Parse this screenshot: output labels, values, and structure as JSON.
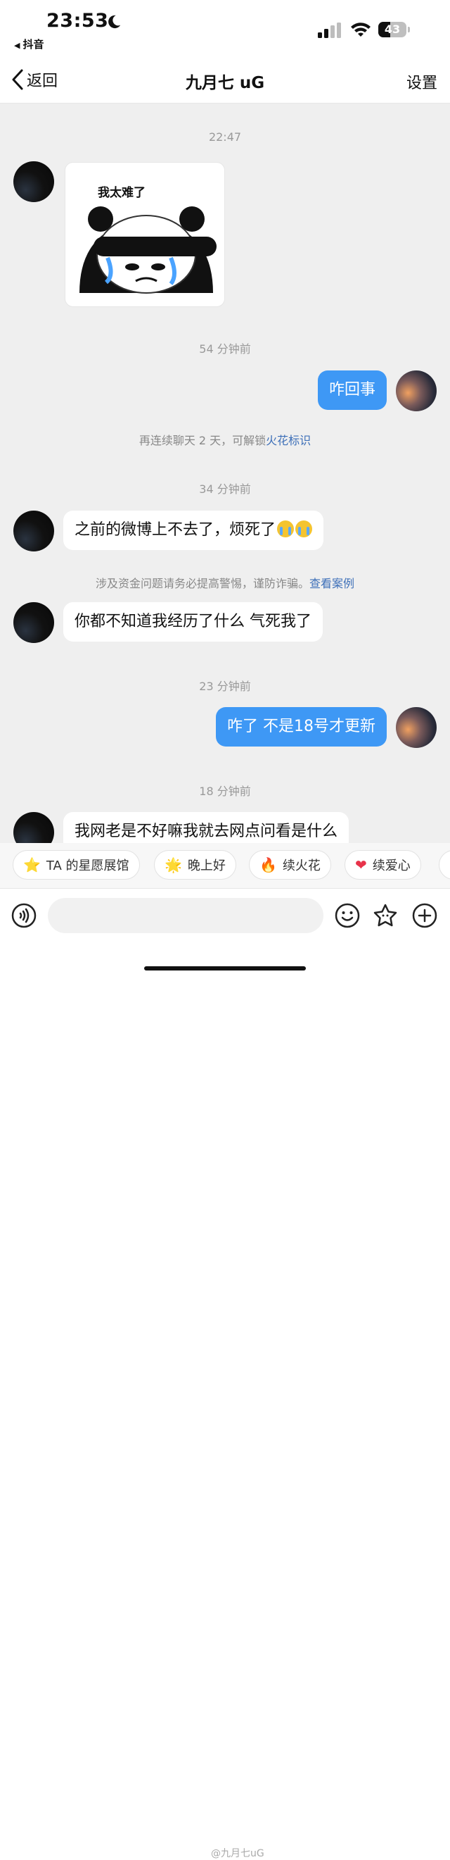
{
  "status_bar": {
    "time": "23:53",
    "back_app": "抖音",
    "battery": "43",
    "battery_level": 0.43
  },
  "nav": {
    "back_label": "返回",
    "title": "九月七 uG",
    "settings_label": "设置"
  },
  "chat": {
    "timestamps": [
      "22:47",
      "54 分钟前",
      "34 分钟前",
      "23 分钟前",
      "18 分钟前"
    ],
    "sticker_caption": "我太难了",
    "messages": [
      {
        "text": "咋回事"
      },
      {
        "text": "之前的微博上不去了，烦死了"
      },
      {
        "text": "你都不知道我经历了什么 气死我了"
      },
      {
        "text": "咋了 不是18号才更新"
      },
      {
        "text": "我网老是不好嘛我就去网点问看是什么"
      }
    ],
    "notice_streak": {
      "text": "再连续聊天 2 天，可解锁",
      "link": "火花标识"
    },
    "notice_fraud": {
      "text": "涉及资金问题请务必提高警惕，谨防诈骗。",
      "link": "查看案例"
    }
  },
  "quick_replies": [
    {
      "icon": "star-icon",
      "label": "TA 的星愿展馆"
    },
    {
      "icon": "star-smile-icon",
      "label": "晚上好"
    },
    {
      "icon": "fire-icon",
      "label": "续火花"
    },
    {
      "icon": "heart-icon",
      "label": "续爱心"
    }
  ],
  "input": {
    "placeholder": ""
  },
  "watermark": "@九月七uG",
  "colors": {
    "outgoing_bubble": "#3e98f5",
    "chat_background": "#efefef",
    "link": "#3d6fb8"
  }
}
